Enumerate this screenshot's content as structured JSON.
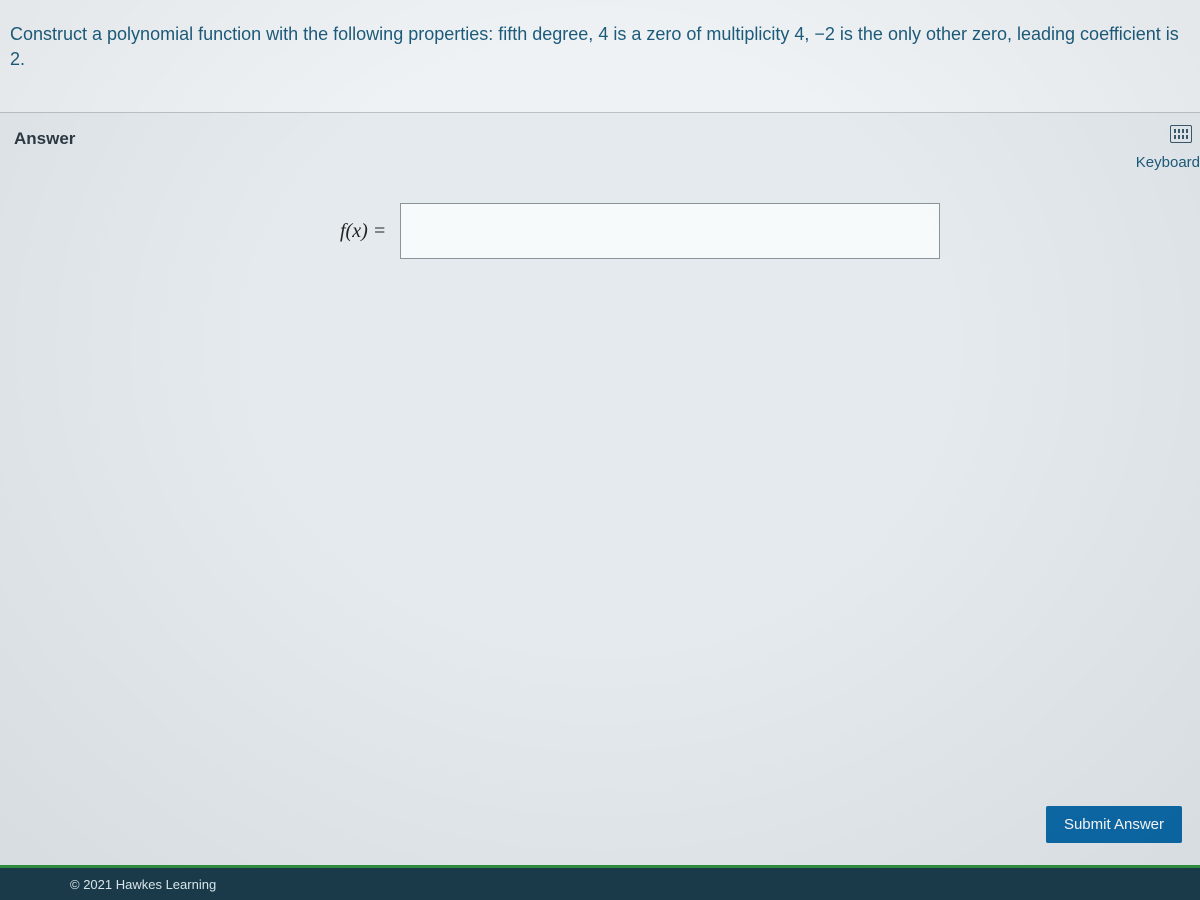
{
  "question": {
    "prompt_parts": [
      "Construct a polynomial function with the following properties: fifth degree, ",
      "4",
      " is a zero of multiplicity ",
      "4",
      ", ",
      "−2",
      " is the only other zero, leading coefficient is ",
      "2",
      "."
    ],
    "prompt_full": "Construct a polynomial function with the following properties: fifth degree, 4 is a zero of multiplicity 4, −2 is the only other zero, leading coefficient is 2."
  },
  "answer_section": {
    "label": "Answer",
    "keyboard_label": "Keyboard",
    "fx_label": "f(x) =",
    "input_value": ""
  },
  "buttons": {
    "submit": "Submit Answer"
  },
  "footer": {
    "copyright": "© 2021 Hawkes Learning"
  }
}
